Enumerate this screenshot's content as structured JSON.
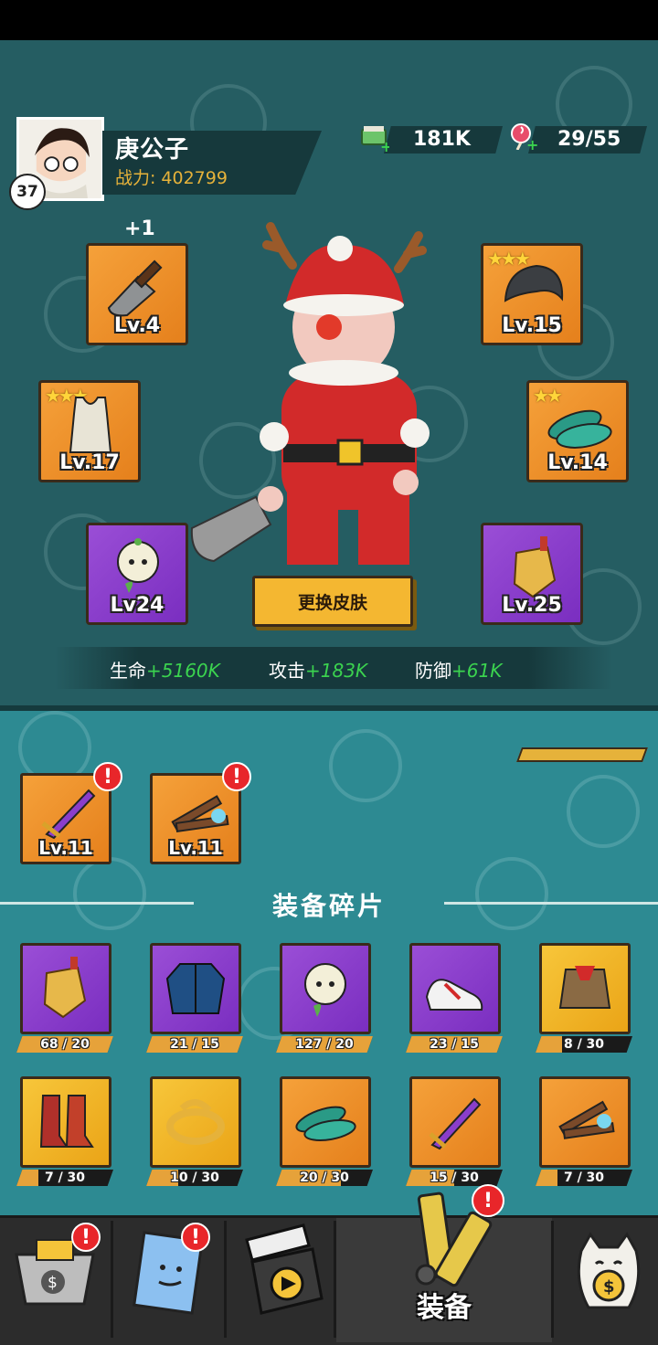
{
  "profile": {
    "name": "庚公子",
    "power_label": "战力:",
    "power_value": "402799",
    "level": "37"
  },
  "currencies": {
    "cash": "181K",
    "stamina": "29/55"
  },
  "equipped": {
    "plus_badge": "+1",
    "cleaver": {
      "level": "Lv.4"
    },
    "helmet": {
      "level": "Lv.15",
      "stars": "★★★"
    },
    "tanktop": {
      "level": "Lv.17",
      "stars": "★★★"
    },
    "flipflops": {
      "level": "Lv.14",
      "stars": "★★"
    },
    "pet": {
      "level": "Lv24"
    },
    "amulet": {
      "level": "Lv.25"
    }
  },
  "skin_button": "更换皮肤",
  "stats": {
    "hp_label": "生命",
    "hp_value": "+5160K",
    "atk_label": "攻击",
    "atk_value": "+183K",
    "def_label": "防御",
    "def_value": "+61K"
  },
  "inventory": [
    {
      "name": "purple-sword",
      "level": "Lv.11",
      "alert": "!"
    },
    {
      "name": "nunchaku",
      "level": "Lv.11",
      "alert": "!"
    }
  ],
  "fragments_title": "装备碎片",
  "fragments": [
    {
      "name": "amulet",
      "count": "68 / 20",
      "progress": 1.0
    },
    {
      "name": "jacket",
      "count": "21 / 15",
      "progress": 1.0
    },
    {
      "name": "pet",
      "count": "127 / 20",
      "progress": 1.0
    },
    {
      "name": "sneakers",
      "count": "23 / 15",
      "progress": 1.0
    },
    {
      "name": "vest",
      "count": "8 / 30",
      "progress": 0.27
    },
    {
      "name": "boots",
      "count": "7 / 30",
      "progress": 0.23
    },
    {
      "name": "ring",
      "count": "10 / 30",
      "progress": 0.33
    },
    {
      "name": "flipflops",
      "count": "20 / 30",
      "progress": 0.67
    },
    {
      "name": "sword",
      "count": "15 / 30",
      "progress": 0.5
    },
    {
      "name": "nunchaku",
      "count": "7 / 30",
      "progress": 0.23
    }
  ],
  "nav": {
    "active_label": "装备",
    "alert": "!"
  },
  "colors": {
    "upper_bg": "#255d62",
    "lower_bg": "#2d8a92",
    "stat_green": "#3bd34f",
    "power_gold": "#e6b23a",
    "purple_slot": "#8a3ecb",
    "orange_slot": "#f0902a"
  }
}
